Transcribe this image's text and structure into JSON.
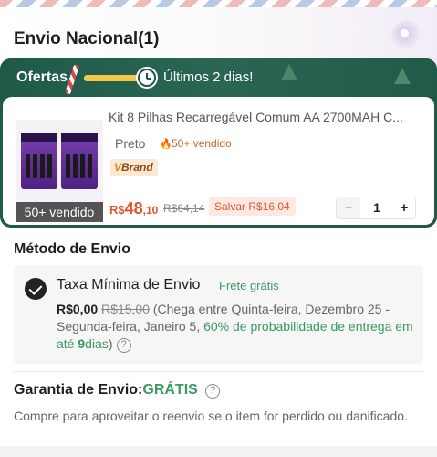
{
  "header": {
    "title": "Envio Nacional(1)"
  },
  "offer": {
    "label": "Ofertas",
    "timer_text": "Últimos 2 dias!",
    "progress": 0.85
  },
  "product": {
    "title": "Kit 8 Pilhas Recarregável Comum AA 2700MAH C...",
    "image_badge": "50+ vendido",
    "variant": "Preto",
    "variant_sold": "50+ vendido",
    "brand_badge_prefix": "V",
    "brand_badge": "Brand",
    "price_currency": "R$",
    "price_main": "48",
    "price_cents": ",10",
    "old_price": "R$64,14",
    "save_text": "Salvar R$16,04",
    "quantity": "1",
    "minus_symbol": "−",
    "plus_symbol": "+"
  },
  "shipping": {
    "section_title": "Método de Envio",
    "option_name": "Taxa Mínima de Envio",
    "free_tag": "Frete grátis",
    "price_now": "R$0,00",
    "price_old": "R$15,00",
    "eta_text": " (Chega entre Quinta-feira, Dezembro 25 - Segunda-feira, Janeiro 5, ",
    "probability_prefix": "60% de probabilidade de entrega em até ",
    "probability_days": "9",
    "probability_suffix": "dias",
    "closing": ")"
  },
  "guarantee": {
    "title": "Garantia de Envio:",
    "status": "GRÁTIS",
    "description": "Compre para aproveitar o reenvio se o item for perdido ou danificado."
  },
  "icons": {
    "help": "?",
    "fire": "🔥"
  }
}
